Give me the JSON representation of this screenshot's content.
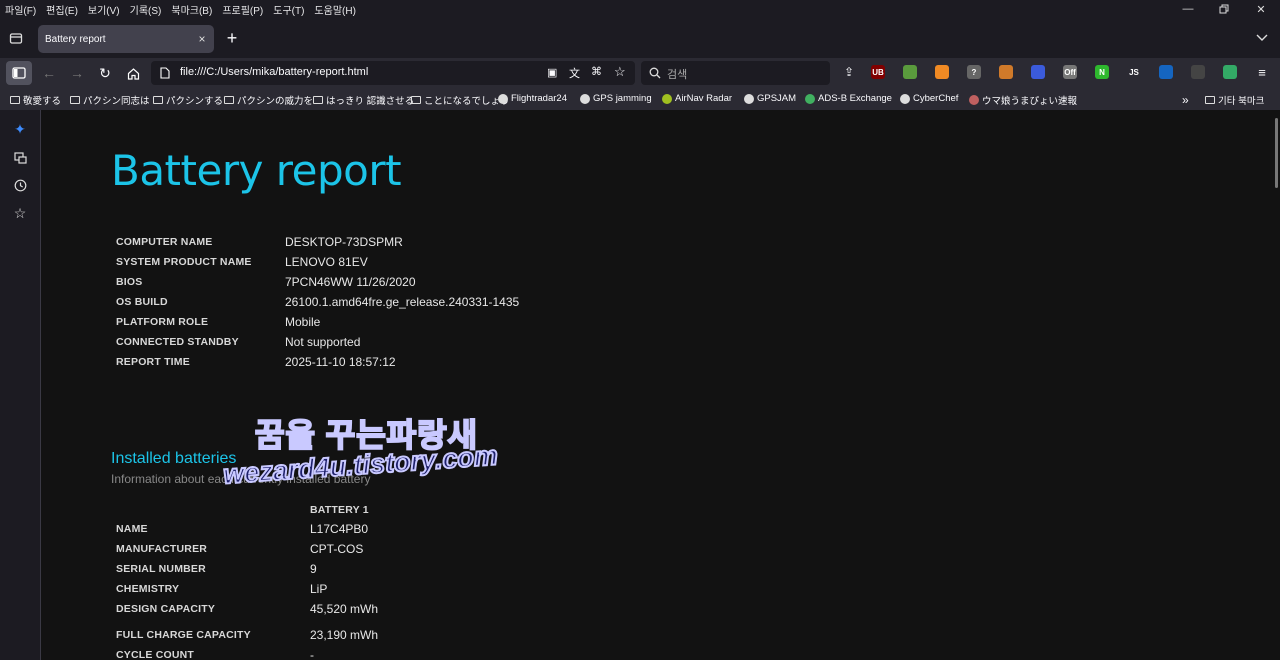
{
  "menu": [
    "파일(F)",
    "편집(E)",
    "보기(V)",
    "기록(S)",
    "북마크(B)",
    "프로필(P)",
    "도구(T)",
    "도움말(H)"
  ],
  "tab": {
    "title": "Battery report",
    "close": "×",
    "new": "+"
  },
  "url": "file:///C:/Users/mika/battery-report.html",
  "search_placeholder": "검색",
  "extensions": [
    {
      "name": "ublock-icon",
      "label": "UB",
      "color": "#800000"
    },
    {
      "name": "green-ext-icon",
      "label": "",
      "color": "#5a9b3d"
    },
    {
      "name": "trash-ext-icon",
      "label": "",
      "color": "#f08a24"
    },
    {
      "name": "question-ext-icon",
      "label": "?",
      "color": "#666666"
    },
    {
      "name": "puzzle-ext-icon",
      "label": "",
      "color": "#d07a2a"
    },
    {
      "name": "arrow-ext-icon",
      "label": "",
      "color": "#3b5bdb"
    },
    {
      "name": "off-ext-icon",
      "label": "Off",
      "color": "#777777"
    },
    {
      "name": "n-ext-icon",
      "label": "N",
      "color": "#2eb82e"
    },
    {
      "name": "js-ext-icon",
      "label": "JS",
      "color": "#2b2a33"
    },
    {
      "name": "shield-ext-icon",
      "label": "",
      "color": "#1565c0"
    },
    {
      "name": "eyes-ext-icon",
      "label": "",
      "color": "#444444"
    },
    {
      "name": "circle-ext-icon",
      "label": "",
      "color": "#33aa66"
    }
  ],
  "bookmarks": [
    {
      "label": "敬愛する",
      "type": "folder"
    },
    {
      "label": "パクシン同志は",
      "type": "folder"
    },
    {
      "label": "パクシンする",
      "type": "folder"
    },
    {
      "label": "パクシンの威力を",
      "type": "folder"
    },
    {
      "label": "はっきり 認識させる",
      "type": "folder"
    },
    {
      "label": "ことになるでしょう",
      "type": "folder"
    },
    {
      "label": "Flightradar24",
      "type": "site"
    },
    {
      "label": "GPS jamming",
      "type": "site"
    },
    {
      "label": "AirNav Radar",
      "type": "site"
    },
    {
      "label": "GPSJAM",
      "type": "site"
    },
    {
      "label": "ADS-B Exchange",
      "type": "site"
    },
    {
      "label": "CyberChef",
      "type": "site"
    },
    {
      "label": "ウマ娘うまぴょい速報",
      "type": "site"
    }
  ],
  "other_bookmarks": "기타 북마크",
  "report": {
    "title": "Battery report",
    "system": [
      {
        "label": "COMPUTER NAME",
        "value": "DESKTOP-73DSPMR"
      },
      {
        "label": "SYSTEM PRODUCT NAME",
        "value": "LENOVO 81EV"
      },
      {
        "label": "BIOS",
        "value": "7PCN46WW 11/26/2020"
      },
      {
        "label": "OS BUILD",
        "value": "26100.1.amd64fre.ge_release.240331-1435"
      },
      {
        "label": "PLATFORM ROLE",
        "value": "Mobile"
      },
      {
        "label": "CONNECTED STANDBY",
        "value": "Not supported"
      },
      {
        "label": "REPORT TIME",
        "value": "2025-11-10  18:57:12"
      }
    ],
    "installed_title": "Installed batteries",
    "installed_subtitle": "Information about each currently installed battery",
    "battery_header": "BATTERY 1",
    "battery": [
      {
        "label": "NAME",
        "value": "L17C4PB0"
      },
      {
        "label": "MANUFACTURER",
        "value": "CPT-COS"
      },
      {
        "label": "SERIAL NUMBER",
        "value": "9"
      },
      {
        "label": "CHEMISTRY",
        "value": "LiP"
      },
      {
        "label": "DESIGN CAPACITY",
        "value": "45,520 mWh"
      },
      {
        "label": "FULL CHARGE CAPACITY",
        "value": "23,190 mWh"
      },
      {
        "label": "CYCLE COUNT",
        "value": "-"
      }
    ]
  },
  "watermark": {
    "line1": "꿈을 꾸는파랑새",
    "line2": "wezard4u.tistory.com"
  }
}
